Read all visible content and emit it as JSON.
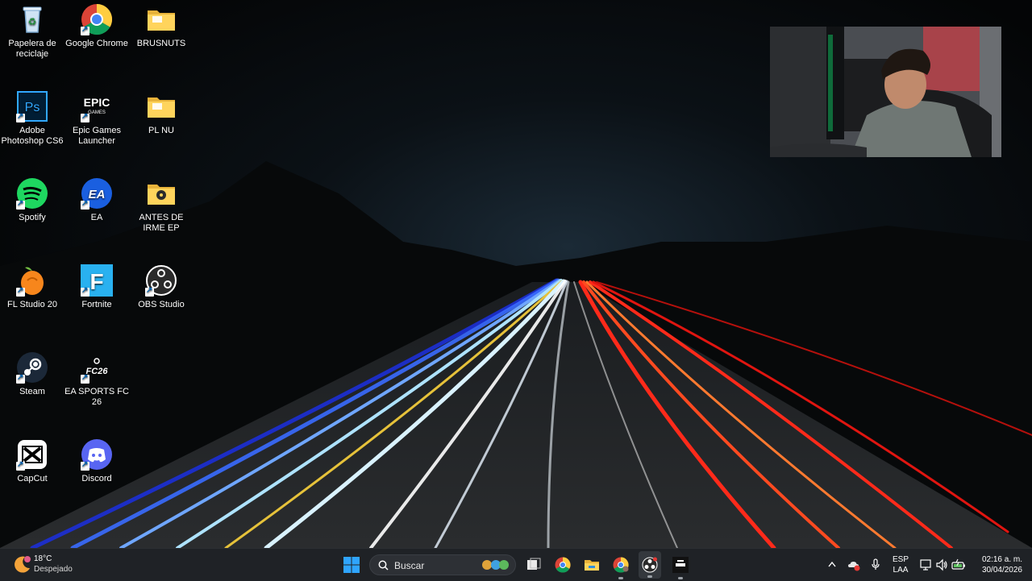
{
  "desktop": {
    "icons": [
      {
        "label": "Papelera de reciclaje",
        "icon": "recycle-bin-icon"
      },
      {
        "label": "Google Chrome",
        "icon": "chrome-icon"
      },
      {
        "label": "BRUSNUTS",
        "icon": "folder-icon"
      },
      {
        "label": "Adobe Photoshop CS6",
        "icon": "photoshop-icon"
      },
      {
        "label": "Epic Games Launcher",
        "icon": "epic-games-icon"
      },
      {
        "label": "PL NU",
        "icon": "folder-icon"
      },
      {
        "label": "Spotify",
        "icon": "spotify-icon"
      },
      {
        "label": "EA",
        "icon": "ea-icon"
      },
      {
        "label": "ANTES DE IRME EP",
        "icon": "folder-icon"
      },
      {
        "label": "FL Studio 20",
        "icon": "fl-studio-icon"
      },
      {
        "label": "Fortnite",
        "icon": "fortnite-icon"
      },
      {
        "label": "OBS Studio",
        "icon": "obs-icon"
      },
      {
        "label": "Steam",
        "icon": "steam-icon"
      },
      {
        "label": "EA SPORTS FC 26",
        "icon": "fc26-icon"
      },
      {
        "label": "CapCut",
        "icon": "capcut-icon"
      },
      {
        "label": "Discord",
        "icon": "discord-icon"
      }
    ],
    "photoshop_glyph": "Ps",
    "epic_glyph": "EPIC",
    "epic_sub": "GAMES",
    "ea_glyph": "EA",
    "fortnite_glyph": "F",
    "fc_glyph": "FC26"
  },
  "taskbar": {
    "weather": {
      "temp": "18°C",
      "condition": "Despejado"
    },
    "search_label": "Buscar",
    "language": {
      "line1": "ESP",
      "line2": "LAA"
    },
    "clock": {
      "time": "02:16 a. m.",
      "date": "30/04/2026"
    }
  },
  "colors": {
    "taskbar_bg": "#1f2226",
    "accent": "#0078d4",
    "trail_red": "#ff2a1a",
    "trail_blue": "#3a6cff"
  }
}
